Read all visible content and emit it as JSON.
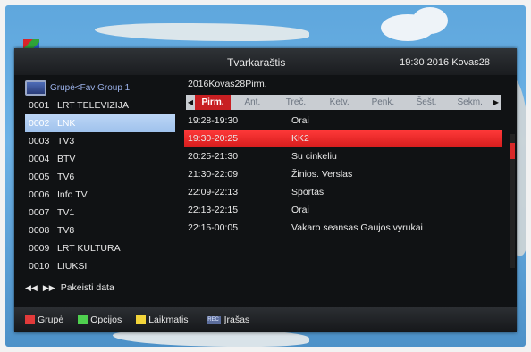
{
  "window": {
    "title": "Tvarkaraštis",
    "clock": "19:30 2016 Kovas28"
  },
  "channel_panel": {
    "group_label": "Grupė<Fav Group 1",
    "channels": [
      {
        "num": "0001",
        "name": "LRT TELEVIZIJA"
      },
      {
        "num": "0002",
        "name": "LNK",
        "selected": true
      },
      {
        "num": "0003",
        "name": "TV3"
      },
      {
        "num": "0004",
        "name": "BTV"
      },
      {
        "num": "0005",
        "name": "TV6"
      },
      {
        "num": "0006",
        "name": "Info TV"
      },
      {
        "num": "0007",
        "name": "TV1"
      },
      {
        "num": "0008",
        "name": "TV8"
      },
      {
        "num": "0009",
        "name": "LRT KULTURA"
      },
      {
        "num": "0010",
        "name": "LIUKSI"
      }
    ]
  },
  "epg": {
    "date_label": "2016Kovas28Pirm.",
    "days": [
      "Pirm.",
      "Ant.",
      "Treč.",
      "Ketv.",
      "Penk.",
      "Šešt.",
      "Sekm."
    ],
    "active_day": "Pirm.",
    "events": [
      {
        "time": "19:28-19:30",
        "title": "Orai"
      },
      {
        "time": "19:30-20:25",
        "title": "KK2",
        "selected": true
      },
      {
        "time": "20:25-21:30",
        "title": "Su cinkeliu"
      },
      {
        "time": "21:30-22:09",
        "title": "Žinios. Verslas"
      },
      {
        "time": "22:09-22:13",
        "title": "Sportas"
      },
      {
        "time": "22:13-22:15",
        "title": "Orai"
      },
      {
        "time": "22:15-00:05",
        "title": "Vakaro seansas Gaujos vyrukai"
      }
    ]
  },
  "navigation": {
    "change_date": "Pakeisti data"
  },
  "legend": {
    "red": "Grupė",
    "green": "Opcijos",
    "yellow": "Laikmatis",
    "rec_badge": "REC",
    "rec": "Įrašas"
  },
  "colors": {
    "red": "#e23a3a",
    "green": "#4fd04f",
    "yellow": "#f2d43a",
    "selected_event": "#e02424",
    "selected_channel": "#a9c9f0"
  }
}
